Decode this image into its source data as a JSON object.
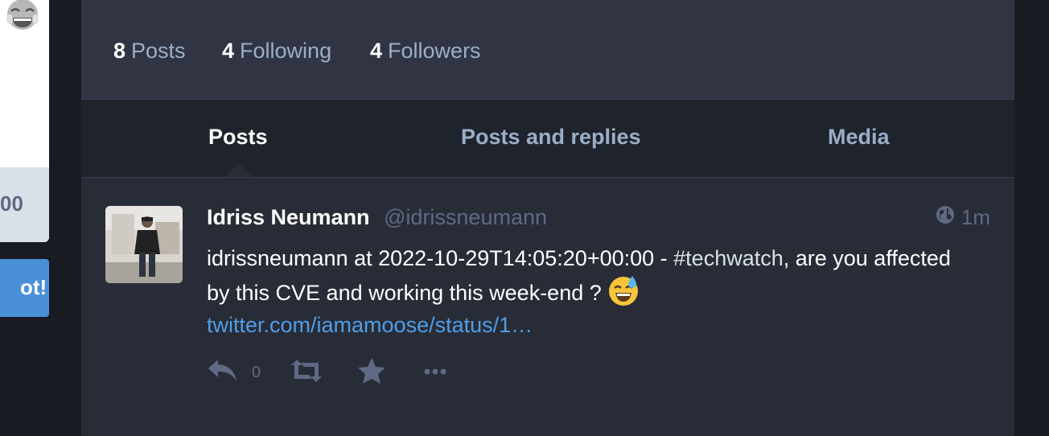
{
  "colors": {
    "background": "#191b22",
    "column": "#282c37",
    "header": "#313543",
    "tabs": "#1f232b",
    "link": "#4f9ee8",
    "muted": "#606984",
    "accent_button": "#4a90d9"
  },
  "left_sidebar": {
    "strip_text": "00",
    "button_label": "ot!"
  },
  "counters": [
    {
      "count": "8",
      "label": "Posts"
    },
    {
      "count": "4",
      "label": "Following"
    },
    {
      "count": "4",
      "label": "Followers"
    }
  ],
  "tabs": [
    {
      "label": "Posts",
      "active": true
    },
    {
      "label": "Posts and replies",
      "active": false
    },
    {
      "label": "Media",
      "active": false
    }
  ],
  "status": {
    "display_name": "Idriss Neumann",
    "acct": "@idrissneumann",
    "visibility_icon": "globe-icon",
    "relative_time": "1m",
    "text_before_hashtag": "idrissneumann at 2022-10-29T14:05:20+00:00 - ",
    "hashtag": "#techwatch",
    "text_after_hashtag": ", are you affected by this CVE and working this week-end ? ",
    "emoji": "sweat-smile-emoji",
    "link": "twitter.com/iamamoose/status/1…",
    "reply_count": "0"
  }
}
